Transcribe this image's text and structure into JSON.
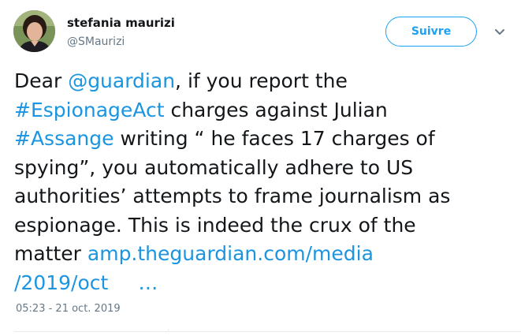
{
  "author": {
    "name": "stefania maurizi",
    "handle": "@SMaurizi"
  },
  "follow_button": {
    "label": "Suivre"
  },
  "tweet": {
    "lines": [
      [
        {
          "text": "Dear "
        },
        {
          "text": "@guardian",
          "link": true
        },
        {
          "text": ", if you report the"
        }
      ],
      [
        {
          "text": "#EspionageAct",
          "link": true
        },
        {
          "text": " charges against Julian"
        }
      ],
      [
        {
          "text": "#Assange",
          "link": true
        },
        {
          "text": " writing “ he faces 17 charges of"
        }
      ],
      [
        {
          "text": "spying”, you automatically adhere to US"
        }
      ],
      [
        {
          "text": "authorities’ attempts to frame journalism as"
        }
      ],
      [
        {
          "text": "espionage. This is indeed the crux of the"
        }
      ],
      [
        {
          "text": "matter "
        },
        {
          "text": "amp.theguardian.com/media",
          "link": true
        }
      ],
      [
        {
          "text": "/2019/oct",
          "link": true
        },
        {
          "text": "…",
          "link": true,
          "ellipsis": true
        }
      ]
    ],
    "timestamp": "05:23 - 21 oct. 2019"
  },
  "icons": {
    "avatar": "profile-photo",
    "caret": "chevron-down-icon"
  },
  "colors": {
    "link": "#1b95e0",
    "follow": "#1da1f2",
    "muted": "#657786",
    "text": "#14171a"
  }
}
